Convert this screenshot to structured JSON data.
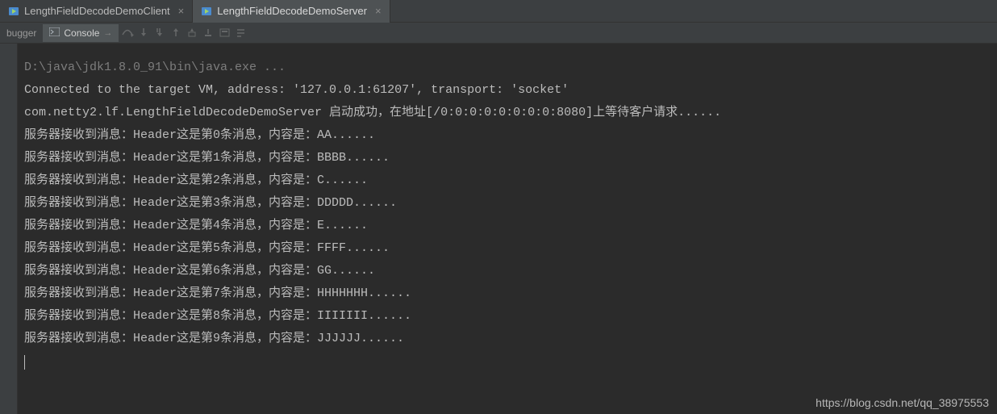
{
  "tabs": [
    {
      "label": "LengthFieldDecodeDemoClient",
      "active": false
    },
    {
      "label": "LengthFieldDecodeDemoServer",
      "active": true
    }
  ],
  "toolbar": {
    "debugger_label": "bugger",
    "console_label": "Console"
  },
  "console": {
    "cmd": "D:\\java\\jdk1.8.0_91\\bin\\java.exe ...",
    "lines": [
      "Connected to the target VM, address: '127.0.0.1:61207', transport: 'socket'",
      "com.netty2.lf.LengthFieldDecodeDemoServer 启动成功，在地址[/0:0:0:0:0:0:0:0:8080]上等待客户请求......",
      "服务器接收到消息：Header这是第0条消息，内容是：AA......",
      "服务器接收到消息：Header这是第1条消息，内容是：BBBB......",
      "服务器接收到消息：Header这是第2条消息，内容是：C......",
      "服务器接收到消息：Header这是第3条消息，内容是：DDDDD......",
      "服务器接收到消息：Header这是第4条消息，内容是：E......",
      "服务器接收到消息：Header这是第5条消息，内容是：FFFF......",
      "服务器接收到消息：Header这是第6条消息，内容是：GG......",
      "服务器接收到消息：Header这是第7条消息，内容是：HHHHHHH......",
      "服务器接收到消息：Header这是第8条消息，内容是：IIIIIII......",
      "服务器接收到消息：Header这是第9条消息，内容是：JJJJJJ......"
    ]
  },
  "watermark": "https://blog.csdn.net/qq_38975553"
}
